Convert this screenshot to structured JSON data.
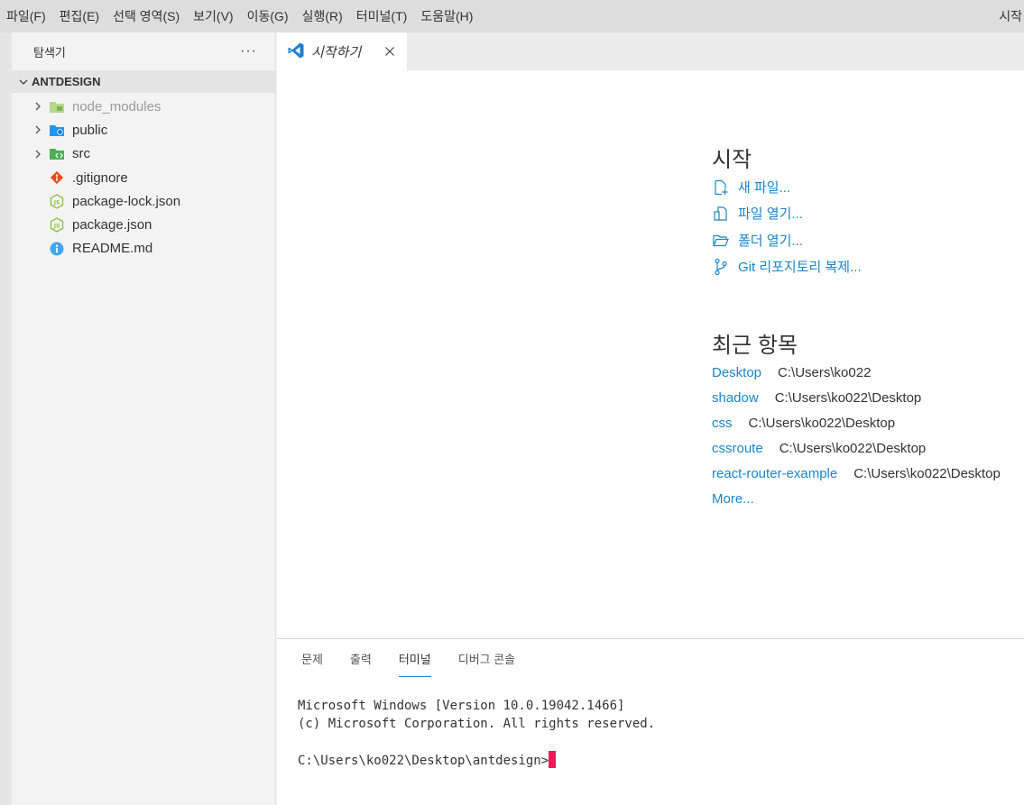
{
  "menubar": {
    "items": [
      "파일(F)",
      "편집(E)",
      "선택 영역(S)",
      "보기(V)",
      "이동(G)",
      "실행(R)",
      "터미널(T)",
      "도움말(H)"
    ],
    "window_title_fragment": "시작"
  },
  "sidebar": {
    "title": "탐색기",
    "more": "···",
    "folder": "ANTDESIGN",
    "items": [
      {
        "label": "node_modules",
        "icon": "node-modules-folder-icon",
        "expandable": true,
        "dimmed": true
      },
      {
        "label": "public",
        "icon": "public-folder-icon",
        "expandable": true,
        "dimmed": false
      },
      {
        "label": "src",
        "icon": "src-folder-icon",
        "expandable": true,
        "dimmed": false
      },
      {
        "label": ".gitignore",
        "icon": "git-icon",
        "expandable": false,
        "dimmed": false
      },
      {
        "label": "package-lock.json",
        "icon": "nodejs-icon",
        "expandable": false,
        "dimmed": false
      },
      {
        "label": "package.json",
        "icon": "nodejs-icon",
        "expandable": false,
        "dimmed": false
      },
      {
        "label": "README.md",
        "icon": "info-icon",
        "expandable": false,
        "dimmed": false
      }
    ]
  },
  "tab": {
    "label": "시작하기"
  },
  "welcome": {
    "start_title": "시작",
    "actions": [
      {
        "label": "새 파일...",
        "icon": "new-file-icon"
      },
      {
        "label": "파일 열기...",
        "icon": "open-file-icon"
      },
      {
        "label": "폴더 열기...",
        "icon": "open-folder-icon"
      },
      {
        "label": "Git 리포지토리 복제...",
        "icon": "git-branch-icon"
      }
    ],
    "recent_title": "최근 항목",
    "recent": [
      {
        "name": "Desktop",
        "path": "C:\\Users\\ko022"
      },
      {
        "name": "shadow",
        "path": "C:\\Users\\ko022\\Desktop"
      },
      {
        "name": "css",
        "path": "C:\\Users\\ko022\\Desktop"
      },
      {
        "name": "cssroute",
        "path": "C:\\Users\\ko022\\Desktop"
      },
      {
        "name": "react-router-example",
        "path": "C:\\Users\\ko022\\Desktop"
      }
    ],
    "more_label": "More..."
  },
  "panel": {
    "tabs": [
      "문제",
      "출력",
      "터미널",
      "디버그 콘솔"
    ],
    "active_tab": 2,
    "terminal": {
      "line1": "Microsoft Windows [Version 10.0.19042.1466]",
      "line2": "(c) Microsoft Corporation. All rights reserved.",
      "prompt": "C:\\Users\\ko022\\Desktop\\antdesign>"
    }
  },
  "colors": {
    "accent": "#1a85c8",
    "cursor": "#ee1a5a"
  }
}
